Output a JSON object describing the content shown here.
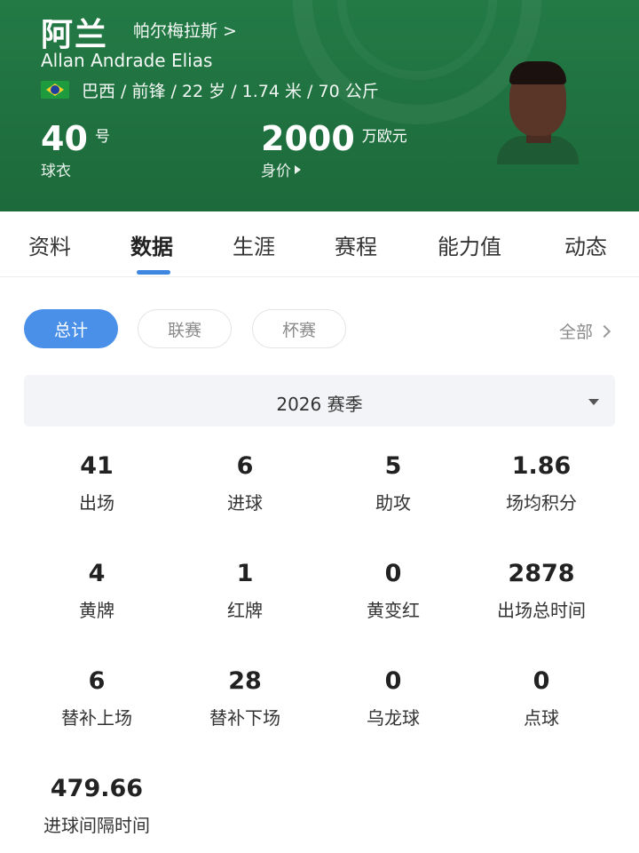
{
  "player": {
    "name_cn": "阿兰",
    "club": "帕尔梅拉斯 >",
    "name_en": "Allan Andrade Elias",
    "info": "巴西 / 前锋 / 22 岁 / 1.74 米 / 70 公斤",
    "jersey_number": "40",
    "jersey_unit": "号",
    "jersey_label": "球衣",
    "market_value": "2000",
    "market_value_unit": "万欧元",
    "market_value_label": "身价"
  },
  "colors": {
    "header_green": "#237a45",
    "accent_blue": "#4a90e8"
  },
  "tabs": [
    {
      "label": "资料"
    },
    {
      "label": "数据"
    },
    {
      "label": "生涯"
    },
    {
      "label": "赛程"
    },
    {
      "label": "能力值"
    },
    {
      "label": "动态"
    }
  ],
  "active_tab": "数据",
  "filters": {
    "chips": [
      {
        "label": "总计"
      },
      {
        "label": "联赛"
      },
      {
        "label": "杯赛"
      }
    ],
    "active": "总计",
    "all_label": "全部"
  },
  "season": {
    "selected": "2026 赛季"
  },
  "stats": [
    {
      "value": "41",
      "label": "出场"
    },
    {
      "value": "6",
      "label": "进球"
    },
    {
      "value": "5",
      "label": "助攻"
    },
    {
      "value": "1.86",
      "label": "场均积分"
    },
    {
      "value": "4",
      "label": "黄牌"
    },
    {
      "value": "1",
      "label": "红牌"
    },
    {
      "value": "0",
      "label": "黄变红"
    },
    {
      "value": "2878",
      "label": "出场总时间"
    },
    {
      "value": "6",
      "label": "替补上场"
    },
    {
      "value": "28",
      "label": "替补下场"
    },
    {
      "value": "0",
      "label": "乌龙球"
    },
    {
      "value": "0",
      "label": "点球"
    },
    {
      "value": "479.66",
      "label": "进球间隔时间"
    }
  ]
}
